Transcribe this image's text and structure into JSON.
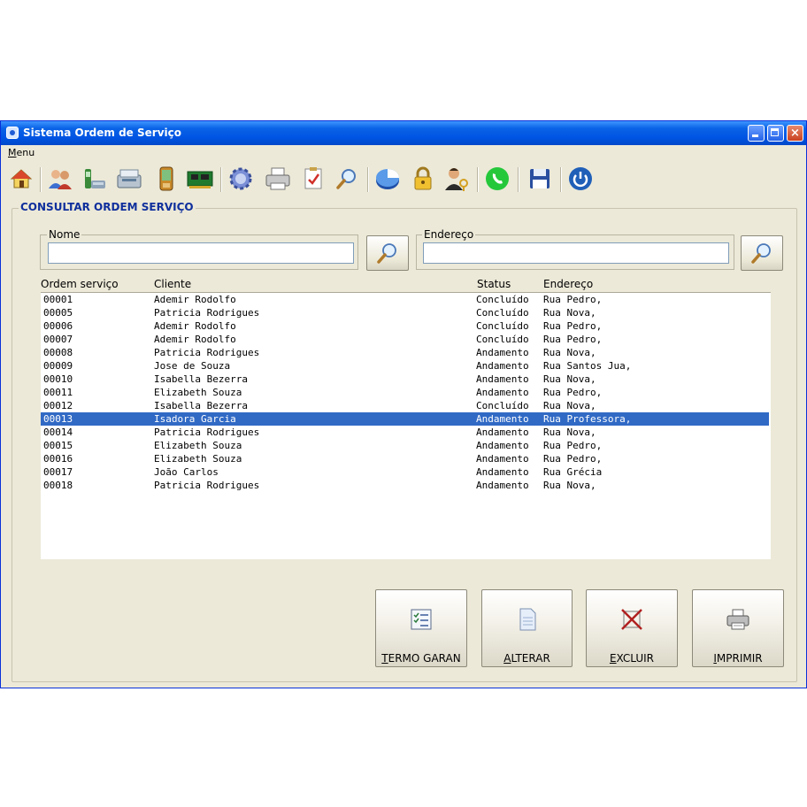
{
  "window": {
    "title": "Sistema Ordem de Serviço",
    "menu_label": "Menu",
    "controls": {
      "minimize": "minimize-icon",
      "maximize": "maximize-icon",
      "close": "×"
    }
  },
  "toolbar": {
    "icons": [
      "home-icon",
      "users-icon",
      "phone-device-icon",
      "scanner-icon",
      "mobile-device-icon",
      "circuit-board-icon",
      "gear-icon",
      "printer-icon",
      "checklist-icon",
      "magnifier-icon",
      "pie-chart-icon",
      "padlock-icon",
      "user-key-icon",
      "whatsapp-icon",
      "floppy-disk-icon",
      "power-icon"
    ]
  },
  "section_title": "CONSULTAR ORDEM SERVIÇO",
  "search": {
    "nome_label": "Nome",
    "nome_value": "",
    "endereco_label": "Endereço",
    "endereco_value": ""
  },
  "table": {
    "columns": [
      "Ordem serviço",
      "Cliente",
      "Status",
      "Endereço"
    ],
    "rows": [
      [
        "00001",
        "Ademir Rodolfo",
        "Concluído",
        "Rua Pedro,"
      ],
      [
        "00005",
        "Patricia Rodrigues",
        "Concluído",
        "Rua Nova,"
      ],
      [
        "00006",
        "Ademir Rodolfo",
        "Concluído",
        "Rua Pedro,"
      ],
      [
        "00007",
        "Ademir Rodolfo",
        "Concluído",
        "Rua Pedro,"
      ],
      [
        "00008",
        "Patricia Rodrigues",
        "Andamento",
        "Rua Nova,"
      ],
      [
        "00009",
        "Jose de Souza",
        "Andamento",
        "Rua Santos Jua,"
      ],
      [
        "00010",
        "Isabella Bezerra",
        "Andamento",
        "Rua Nova,"
      ],
      [
        "00011",
        "Elizabeth Souza",
        "Andamento",
        "Rua Pedro,"
      ],
      [
        "00012",
        "Isabella Bezerra",
        "Concluído",
        "Rua Nova,"
      ],
      [
        "00013",
        "Isadora Garcia",
        "Andamento",
        "Rua Professora,"
      ],
      [
        "00014",
        "Patricia Rodrigues",
        "Andamento",
        "Rua Nova,"
      ],
      [
        "00015",
        "Elizabeth Souza",
        "Andamento",
        "Rua Pedro,"
      ],
      [
        "00016",
        "Elizabeth Souza",
        "Andamento",
        "Rua Pedro,"
      ],
      [
        "00017",
        "João Carlos",
        "Andamento",
        "Rua Grécia"
      ],
      [
        "00018",
        "Patricia Rodrigues",
        "Andamento",
        "Rua Nova,"
      ]
    ],
    "selected_row": "00013"
  },
  "buttons": {
    "termo": "TERMO GARAN",
    "alterar": "ALTERAR",
    "excluir": "EXCLUIR",
    "imprimir": "IMPRIMIR"
  },
  "colors": {
    "titlebar": "#0054e3",
    "selection": "#316ac5",
    "section_title": "#0f2f9c",
    "window_bg": "#ece9d8"
  }
}
